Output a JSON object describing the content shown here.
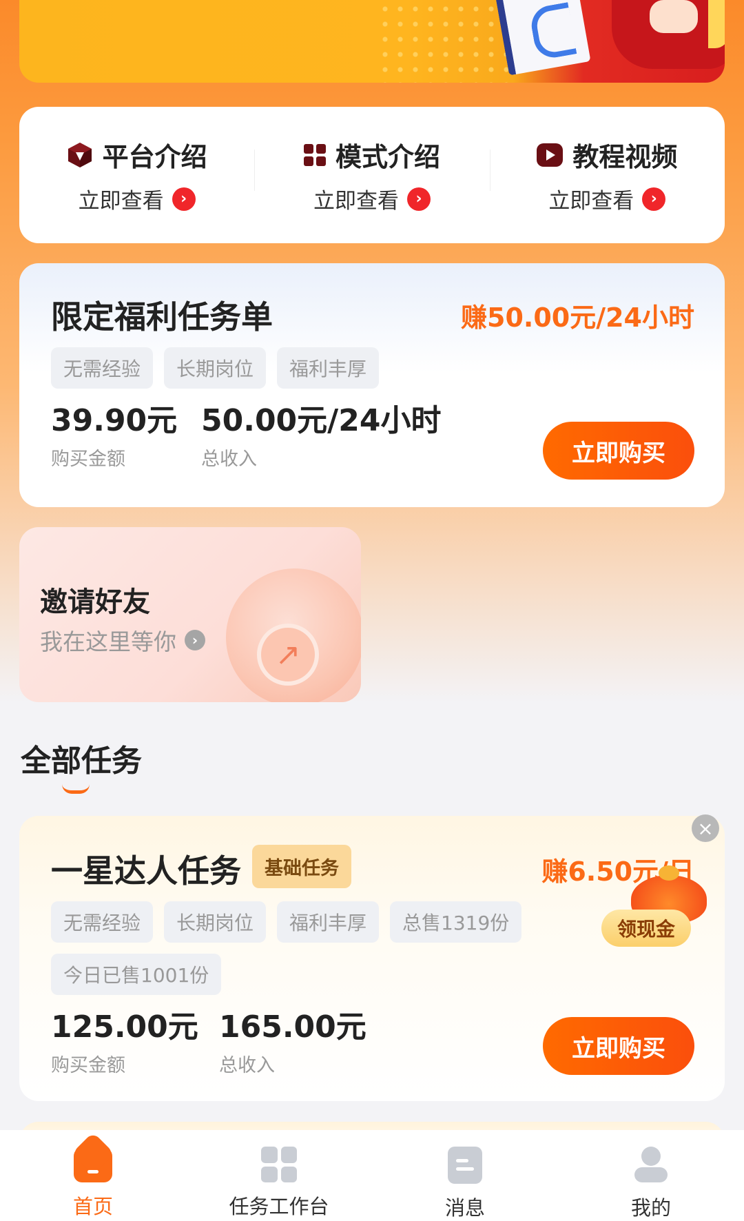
{
  "intro": {
    "items": [
      {
        "title": "平台介绍",
        "sub": "立即查看",
        "icon": "cube-icon"
      },
      {
        "title": "模式介绍",
        "sub": "立即查看",
        "icon": "grid-icon"
      },
      {
        "title": "教程视频",
        "sub": "立即查看",
        "icon": "play-icon"
      }
    ]
  },
  "welfare": {
    "title": "限定福利任务单",
    "earn": "赚50.00元/24小时",
    "tags": [
      "无需经验",
      "长期岗位",
      "福利丰厚"
    ],
    "price": "39.90元",
    "price_label": "购买金额",
    "income": "50.00元/24小时",
    "income_label": "总收入",
    "buy_label": "立即购买"
  },
  "invite": {
    "title": "邀请好友",
    "sub": "我在这里等你"
  },
  "section": {
    "title": "全部任务"
  },
  "task": {
    "title": "一星达人任务",
    "badge": "基础任务",
    "earn": "赚6.50元/日",
    "cash_label": "领现金",
    "tags": [
      "无需经验",
      "长期岗位",
      "福利丰厚",
      "总售1319份",
      "今日已售1001份"
    ],
    "price": "125.00元",
    "price_label": "购买金额",
    "income": "165.00元",
    "income_label": "总收入",
    "buy_label": "立即购买"
  },
  "nav": {
    "items": [
      {
        "label": "首页",
        "active": true
      },
      {
        "label": "任务工作台",
        "active": false
      },
      {
        "label": "消息",
        "active": false
      },
      {
        "label": "我的",
        "active": false
      }
    ]
  },
  "colors": {
    "accent": "#fb6a16",
    "arrow_red": "#f0262a",
    "icon_dark": "#6a0f14"
  }
}
